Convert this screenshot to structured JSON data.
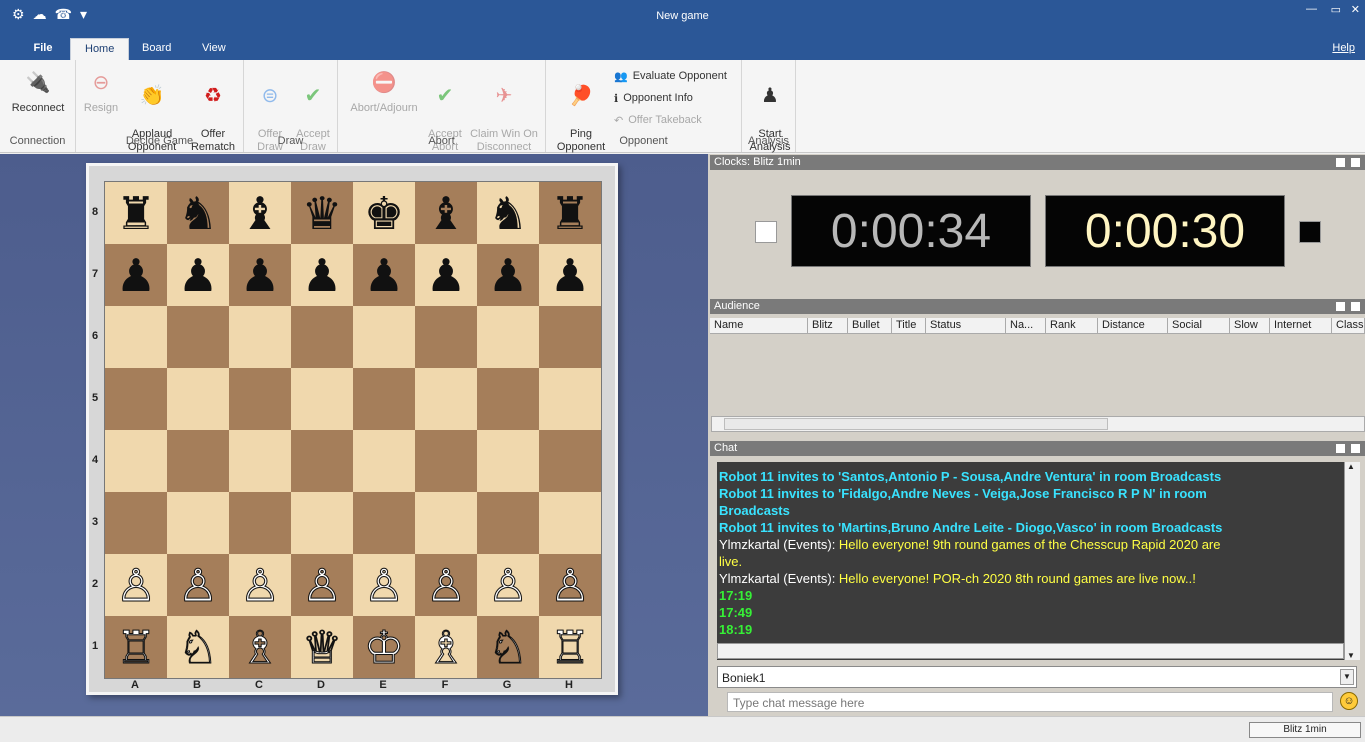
{
  "window": {
    "title": "New game",
    "minimize": "—",
    "restore": "▭",
    "close": "✕"
  },
  "quick_access": [
    "⚙",
    "☁",
    "☎",
    "▾"
  ],
  "ribbon": {
    "tabs": [
      "File",
      "Home",
      "Board",
      "View"
    ],
    "active_tab": "Home",
    "help": "Help",
    "groups": {
      "connection": {
        "name": "Connection",
        "reconnect": "Reconnect"
      },
      "decide_game": {
        "name": "Decide Game",
        "resign": "Resign",
        "applaud": "Applaud\nOpponent",
        "offer_rematch": "Offer\nRematch"
      },
      "draw": {
        "name": "Draw",
        "offer_draw": "Offer\nDraw",
        "accept_draw": "Accept\nDraw"
      },
      "abort": {
        "name": "Abort",
        "abort_adjourn": "Abort/Adjourn",
        "accept_abort": "Accept\nAbort",
        "claim_win": "Claim Win On\nDisconnect"
      },
      "opponent": {
        "name": "Opponent",
        "ping": "Ping\nOpponent",
        "evaluate": "Evaluate Opponent",
        "info": "Opponent Info",
        "takeback": "Offer Takeback"
      },
      "analysis": {
        "name": "Analysis",
        "start_analysis": "Start\nAnalysis"
      }
    }
  },
  "board": {
    "ranks": [
      "8",
      "7",
      "6",
      "5",
      "4",
      "3",
      "2",
      "1"
    ],
    "files": [
      "A",
      "B",
      "C",
      "D",
      "E",
      "F",
      "G",
      "H"
    ],
    "pieces": [
      [
        "♜",
        "♞",
        "♝",
        "♛",
        "♚",
        "♝",
        "♞",
        "♜"
      ],
      [
        "♟",
        "♟",
        "♟",
        "♟",
        "♟",
        "♟",
        "♟",
        "♟"
      ],
      [
        "",
        "",
        "",
        "",
        "",
        "",
        "",
        ""
      ],
      [
        "",
        "",
        "",
        "",
        "",
        "",
        "",
        ""
      ],
      [
        "",
        "",
        "",
        "",
        "",
        "",
        "",
        ""
      ],
      [
        "",
        "",
        "",
        "",
        "",
        "",
        "",
        ""
      ],
      [
        "♙",
        "♙",
        "♙",
        "♙",
        "♙",
        "♙",
        "♙",
        "♙"
      ],
      [
        "♖",
        "♘",
        "♗",
        "♕",
        "♔",
        "♗",
        "♘",
        "♖"
      ]
    ]
  },
  "clocks": {
    "title": "Clocks: Blitz 1min",
    "left_time": "0:00:34",
    "right_time": "0:00:30"
  },
  "audience": {
    "title": "Audience",
    "columns": [
      "Name",
      "Blitz",
      "Bullet",
      "Title",
      "Status",
      "Na...",
      "Rank",
      "Distance",
      "Social",
      "Slow",
      "Internet",
      "Classic"
    ]
  },
  "chat": {
    "title": "Chat",
    "lines": [
      {
        "kind": "robot",
        "text": "Robot 11 invites to 'Santos,Antonio P - Sousa,Andre Ventura' in room Broadcasts"
      },
      {
        "kind": "robot",
        "text": "Robot 11 invites to 'Fidalgo,Andre Neves - Veiga,Jose Francisco R P N' in room"
      },
      {
        "kind": "robot",
        "text": "Broadcasts"
      },
      {
        "kind": "robot",
        "text": "Robot 11 invites to 'Martins,Bruno Andre Leite - Diogo,Vasco' in room Broadcasts"
      },
      {
        "kind": "user",
        "user": "Ylmzkartal (Events):",
        "text": "Hello everyone! 9th round games of the Chesscup Rapid 2020 are"
      },
      {
        "kind": "msg",
        "text": "live."
      },
      {
        "kind": "user",
        "user": "Ylmzkartal (Events):",
        "text": "Hello everyone! POR-ch 2020 8th round games are live now..!"
      },
      {
        "kind": "time",
        "text": "17:19"
      },
      {
        "kind": "time",
        "text": "17:49"
      },
      {
        "kind": "time",
        "text": "18:19"
      }
    ],
    "recipient": "Boniek1",
    "input_placeholder": "Type chat message here"
  },
  "status": {
    "mode": "Blitz 1min"
  }
}
